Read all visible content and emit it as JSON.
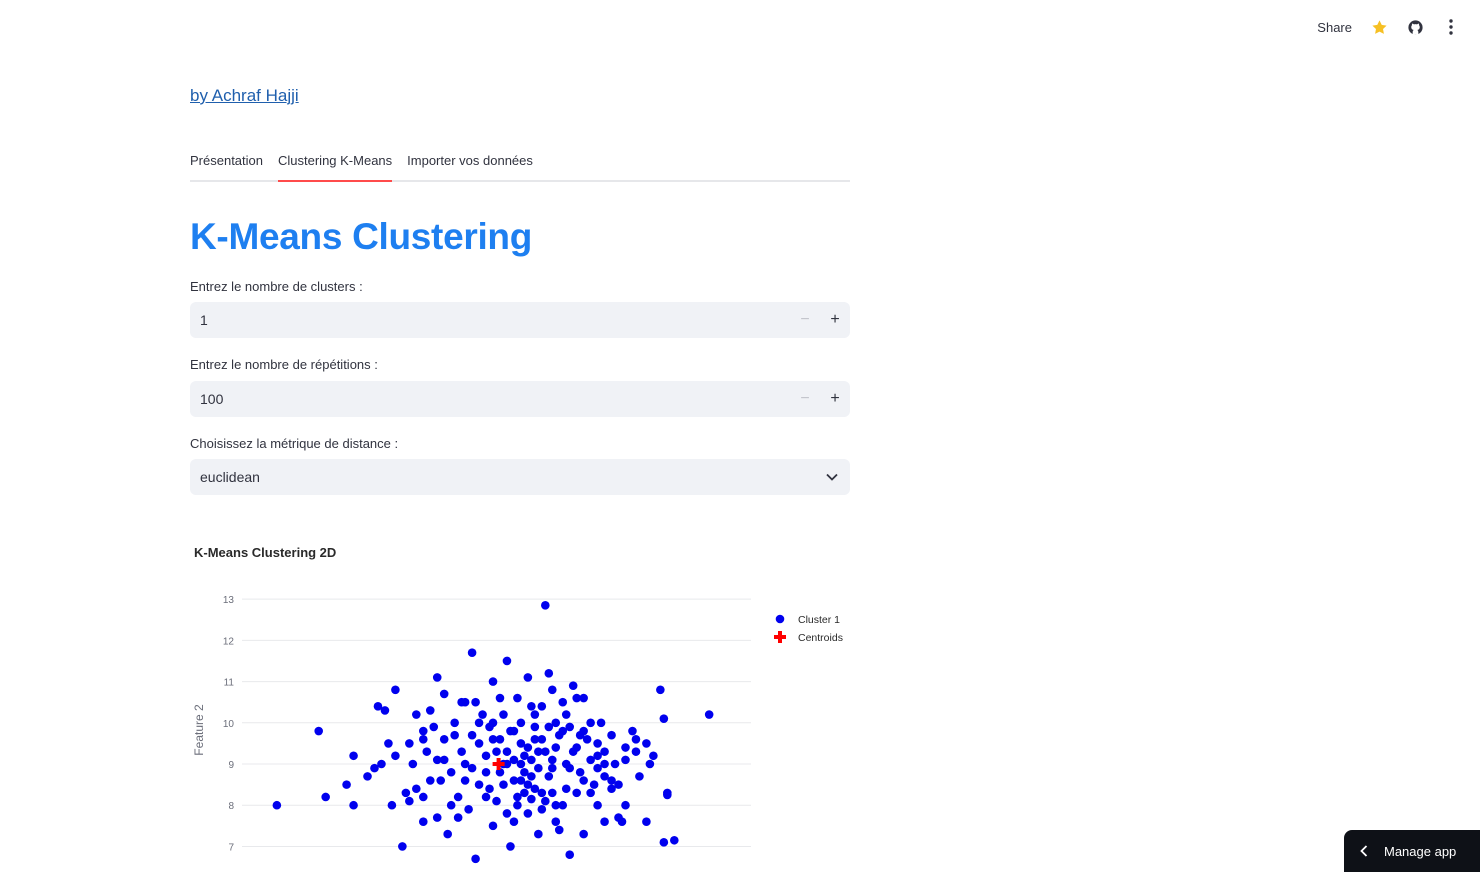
{
  "header": {
    "share_label": "Share",
    "icons": [
      "star-icon",
      "github-icon",
      "kebab-menu-icon"
    ],
    "star_color": "#f6c024"
  },
  "author_link": "by Achraf Hajji",
  "tabs": [
    {
      "label": "Présentation",
      "active": false
    },
    {
      "label": "Clustering K-Means",
      "active": true
    },
    {
      "label": "Importer vos données",
      "active": false
    }
  ],
  "page_title": "K-Means Clustering",
  "inputs": {
    "clusters": {
      "label": "Entrez le nombre de clusters :",
      "value": "1"
    },
    "repetitions": {
      "label": "Entrez le nombre de répétitions :",
      "value": "100"
    },
    "metric": {
      "label": "Choisissez la métrique de distance :",
      "value": "euclidean"
    }
  },
  "chart_data": {
    "type": "scatter",
    "title": "K-Means Clustering 2D",
    "xlabel": "",
    "ylabel": "Feature 2",
    "xlim": [
      -1.6,
      5.7
    ],
    "ylim": [
      6.55,
      13.1
    ],
    "yticks": [
      7,
      8,
      9,
      10,
      11,
      12,
      13
    ],
    "grid": true,
    "legend_position": "top-right",
    "series": [
      {
        "name": "Cluster 1",
        "color": "#0000ee",
        "marker": "circle",
        "points": [
          [
            -1.1,
            8.0
          ],
          [
            -0.5,
            9.8
          ],
          [
            -0.4,
            8.2
          ],
          [
            -0.1,
            8.5
          ],
          [
            0.0,
            9.2
          ],
          [
            0.0,
            8.0
          ],
          [
            0.2,
            8.7
          ],
          [
            0.3,
            8.9
          ],
          [
            0.35,
            10.4
          ],
          [
            0.45,
            10.3
          ],
          [
            0.5,
            9.5
          ],
          [
            0.55,
            8.0
          ],
          [
            0.6,
            10.8
          ],
          [
            0.7,
            7.0
          ],
          [
            0.75,
            8.3
          ],
          [
            0.8,
            9.5
          ],
          [
            0.85,
            9.0
          ],
          [
            0.9,
            8.4
          ],
          [
            1.0,
            9.6
          ],
          [
            1.0,
            7.6
          ],
          [
            1.1,
            8.6
          ],
          [
            1.1,
            10.3
          ],
          [
            1.2,
            11.1
          ],
          [
            1.2,
            9.1
          ],
          [
            1.3,
            10.7
          ],
          [
            1.4,
            8.8
          ],
          [
            1.45,
            9.7
          ],
          [
            1.5,
            7.7
          ],
          [
            1.55,
            9.3
          ],
          [
            1.6,
            10.5
          ],
          [
            1.7,
            8.9
          ],
          [
            1.7,
            11.7
          ],
          [
            1.75,
            6.7
          ],
          [
            1.8,
            9.5
          ],
          [
            1.85,
            10.2
          ],
          [
            1.9,
            8.2
          ],
          [
            1.95,
            9.9
          ],
          [
            2.0,
            11.0
          ],
          [
            2.05,
            9.3
          ],
          [
            2.1,
            10.6
          ],
          [
            2.15,
            8.5
          ],
          [
            2.2,
            11.5
          ],
          [
            2.25,
            7.0
          ],
          [
            2.3,
            9.8
          ],
          [
            2.35,
            8.0
          ],
          [
            2.4,
            10.0
          ],
          [
            2.45,
            9.2
          ],
          [
            2.5,
            11.1
          ],
          [
            2.55,
            8.7
          ],
          [
            2.6,
            9.6
          ],
          [
            2.65,
            7.3
          ],
          [
            2.7,
            10.4
          ],
          [
            2.75,
            12.85
          ],
          [
            2.8,
            11.2
          ],
          [
            2.85,
            8.9
          ],
          [
            2.9,
            9.4
          ],
          [
            2.95,
            7.4
          ],
          [
            3.0,
            10.5
          ],
          [
            3.05,
            9.0
          ],
          [
            3.1,
            6.8
          ],
          [
            3.15,
            10.9
          ],
          [
            3.2,
            8.3
          ],
          [
            3.25,
            9.7
          ],
          [
            3.3,
            7.3
          ],
          [
            3.4,
            9.1
          ],
          [
            3.5,
            8.0
          ],
          [
            3.55,
            10.0
          ],
          [
            3.6,
            9.3
          ],
          [
            3.7,
            8.6
          ],
          [
            3.8,
            7.7
          ],
          [
            3.9,
            9.4
          ],
          [
            4.0,
            9.8
          ],
          [
            4.1,
            8.7
          ],
          [
            4.2,
            9.5
          ],
          [
            4.3,
            9.2
          ],
          [
            4.4,
            10.8
          ],
          [
            4.45,
            7.1
          ],
          [
            4.5,
            8.3
          ],
          [
            4.6,
            7.15
          ],
          [
            5.1,
            10.2
          ],
          [
            1.3,
            9.6
          ],
          [
            1.5,
            8.2
          ],
          [
            1.6,
            9.0
          ],
          [
            1.9,
            8.8
          ],
          [
            2.0,
            7.5
          ],
          [
            2.1,
            9.6
          ],
          [
            2.3,
            8.6
          ],
          [
            2.4,
            9.0
          ],
          [
            2.5,
            7.8
          ],
          [
            2.6,
            10.2
          ],
          [
            2.7,
            8.3
          ],
          [
            2.8,
            9.9
          ],
          [
            2.9,
            8.0
          ],
          [
            3.0,
            9.8
          ],
          [
            3.1,
            8.9
          ],
          [
            3.2,
            9.4
          ],
          [
            3.3,
            8.6
          ],
          [
            3.4,
            10.0
          ],
          [
            3.5,
            9.2
          ],
          [
            3.6,
            7.6
          ],
          [
            3.75,
            9.0
          ],
          [
            3.9,
            8.0
          ],
          [
            4.05,
            9.6
          ],
          [
            4.2,
            7.6
          ],
          [
            4.45,
            10.1
          ],
          [
            4.5,
            8.25
          ],
          [
            0.9,
            10.2
          ],
          [
            1.0,
            8.2
          ],
          [
            1.15,
            9.9
          ],
          [
            1.25,
            8.6
          ],
          [
            1.35,
            7.3
          ],
          [
            1.45,
            10.0
          ],
          [
            1.65,
            7.9
          ],
          [
            1.75,
            10.5
          ],
          [
            1.8,
            8.5
          ],
          [
            2.0,
            10.0
          ],
          [
            2.2,
            9.0
          ],
          [
            2.2,
            7.8
          ],
          [
            2.35,
            10.6
          ],
          [
            2.45,
            8.3
          ],
          [
            2.55,
            10.4
          ],
          [
            2.65,
            9.3
          ],
          [
            2.75,
            8.1
          ],
          [
            2.85,
            10.8
          ],
          [
            2.95,
            9.7
          ],
          [
            3.05,
            8.4
          ],
          [
            3.15,
            9.3
          ],
          [
            3.25,
            8.8
          ],
          [
            3.35,
            9.6
          ],
          [
            3.45,
            8.5
          ],
          [
            3.6,
            9.0
          ],
          [
            3.7,
            9.7
          ],
          [
            3.8,
            8.5
          ],
          [
            3.85,
            7.6
          ],
          [
            4.05,
            9.3
          ],
          [
            4.25,
            9.0
          ],
          [
            0.4,
            9.0
          ],
          [
            0.6,
            9.2
          ],
          [
            0.8,
            8.1
          ],
          [
            1.05,
            9.3
          ],
          [
            1.2,
            7.7
          ],
          [
            1.4,
            8.0
          ],
          [
            1.55,
            10.5
          ],
          [
            1.7,
            9.7
          ],
          [
            1.9,
            9.2
          ],
          [
            2.05,
            8.1
          ],
          [
            2.15,
            10.2
          ],
          [
            2.3,
            7.6
          ],
          [
            2.4,
            9.5
          ],
          [
            2.5,
            8.5
          ],
          [
            2.6,
            9.9
          ],
          [
            2.7,
            7.9
          ],
          [
            2.8,
            8.7
          ],
          [
            2.9,
            10.0
          ],
          [
            3.0,
            8.0
          ],
          [
            3.1,
            9.9
          ],
          [
            3.2,
            10.6
          ],
          [
            3.3,
            9.8
          ],
          [
            3.4,
            8.3
          ],
          [
            3.5,
            9.5
          ],
          [
            3.6,
            8.7
          ],
          [
            3.7,
            8.4
          ],
          [
            3.9,
            9.1
          ],
          [
            1.0,
            9.8
          ],
          [
            1.3,
            9.1
          ],
          [
            1.6,
            8.6
          ],
          [
            1.8,
            10.0
          ],
          [
            2.1,
            8.8
          ],
          [
            2.25,
            9.8
          ],
          [
            2.4,
            8.6
          ],
          [
            2.55,
            9.1
          ],
          [
            2.7,
            9.6
          ],
          [
            2.85,
            9.1
          ],
          [
            2.9,
            7.6
          ],
          [
            3.05,
            10.2
          ],
          [
            3.3,
            10.6
          ],
          [
            3.5,
            8.9
          ],
          [
            2.2,
            9.3
          ],
          [
            2.6,
            8.4
          ],
          [
            2.5,
            9.4
          ],
          [
            2.0,
            9.6
          ],
          [
            2.3,
            9.1
          ],
          [
            2.45,
            8.8
          ],
          [
            2.65,
            8.9
          ],
          [
            2.35,
            8.2
          ],
          [
            2.55,
            8.15
          ],
          [
            2.15,
            9.0
          ],
          [
            1.95,
            8.4
          ],
          [
            2.75,
            9.3
          ],
          [
            2.85,
            8.3
          ]
        ]
      },
      {
        "name": "Centroids",
        "color": "#ff0000",
        "marker": "cross",
        "points": [
          [
            2.08,
            9.0
          ]
        ]
      }
    ]
  },
  "manage_app": "Manage app"
}
